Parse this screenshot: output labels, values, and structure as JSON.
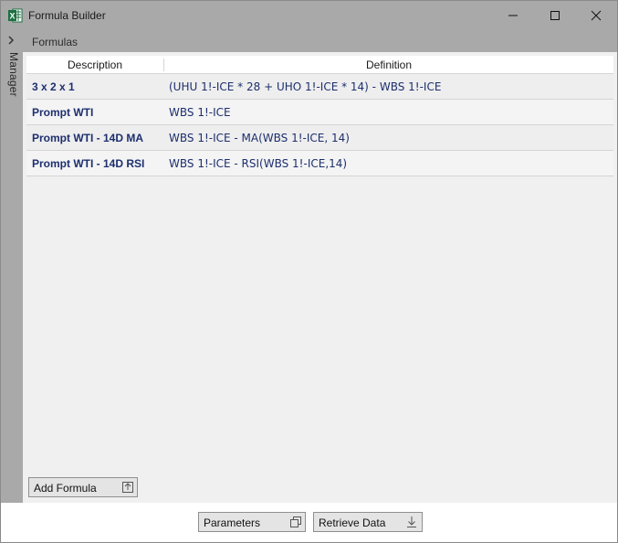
{
  "window": {
    "title": "Formula Builder"
  },
  "sidebar": {
    "tab_label": "Manager"
  },
  "section": {
    "title": "Formulas"
  },
  "grid": {
    "columns": [
      "Description",
      "Definition"
    ],
    "rows": [
      {
        "description": "3 x 2 x 1",
        "definition": "(UHU 1!-ICE * 28 + UHO 1!-ICE * 14) - WBS 1!-ICE"
      },
      {
        "description": "Prompt WTI",
        "definition": "WBS 1!-ICE"
      },
      {
        "description": "Prompt WTI - 14D MA",
        "definition": "WBS 1!-ICE - MA(WBS 1!-ICE, 14)"
      },
      {
        "description": "Prompt WTI - 14D RSI",
        "definition": "WBS 1!-ICE - RSI(WBS 1!-ICE,14)"
      }
    ]
  },
  "buttons": {
    "add_formula": "Add Formula",
    "parameters": "Parameters",
    "retrieve_data": "Retrieve Data"
  },
  "colors": {
    "chrome": "#a9a9a9",
    "cell_text": "#1d2f6e",
    "excel_green": "#1d6f42"
  }
}
